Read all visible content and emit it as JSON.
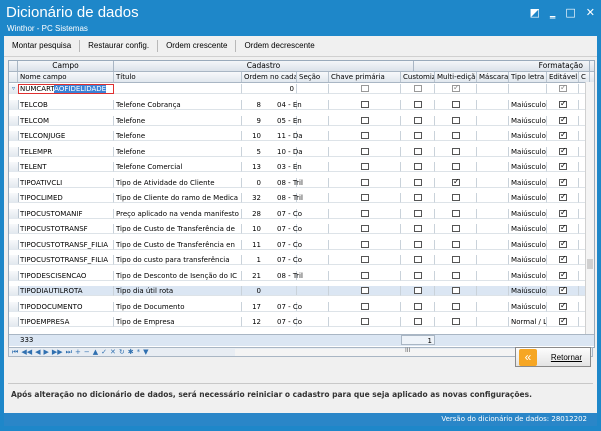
{
  "window": {
    "title": "Dicionário de dados",
    "subtitle": "Winthor - PC Sistemas",
    "buttons": [
      "◩",
      "‗",
      "□",
      "✕"
    ]
  },
  "toolbar": {
    "montar": "Montar pesquisa",
    "restaurar": "Restaurar config.",
    "crescente": "Ordem crescente",
    "decrescente": "Ordem decrescente"
  },
  "grid": {
    "bands": {
      "campo": "Campo",
      "cadastro": "Cadastro",
      "formatacao": "Formatação"
    },
    "headers": {
      "nome": "Nome campo",
      "titulo": "Título",
      "ordem": "Ordem no cadastro",
      "secao": "Seção",
      "chave": "Chave primária",
      "custom": "Customizável",
      "multi": "Multi-edição",
      "mascara": "Máscara",
      "tipoletra": "Tipo letra",
      "editavel": "Editável",
      "extra": "C"
    },
    "edit_row": {
      "nome": "NUMCART",
      "selected": "AOFIDELIDADE",
      "ordem": "0",
      "chave": false,
      "custom": false,
      "multi": true,
      "editavel": true
    },
    "rows": [
      {
        "nome": "TELCOB",
        "titulo": "Telefone Cobrança",
        "ordem": "8",
        "secao": "04 - En",
        "chave": false,
        "custom": false,
        "multi": false,
        "tipoletra": "Maiúsculo",
        "editavel": true
      },
      {
        "nome": "TELCOM",
        "titulo": "Telefone",
        "ordem": "9",
        "secao": "05 - En",
        "chave": false,
        "custom": false,
        "multi": false,
        "tipoletra": "Maiúsculo",
        "editavel": true
      },
      {
        "nome": "TELCONJUGE",
        "titulo": "Telefone",
        "ordem": "10",
        "secao": "11 - Da",
        "chave": false,
        "custom": false,
        "multi": false,
        "tipoletra": "Maiúsculo",
        "editavel": true
      },
      {
        "nome": "TELEMPR",
        "titulo": "Telefone",
        "ordem": "5",
        "secao": "10 - Da",
        "chave": false,
        "custom": false,
        "multi": false,
        "tipoletra": "Maiúsculo",
        "editavel": true
      },
      {
        "nome": "TELENT",
        "titulo": "Telefone Comercial",
        "ordem": "13",
        "secao": "03 - En",
        "chave": false,
        "custom": false,
        "multi": false,
        "tipoletra": "Maiúsculo",
        "editavel": true
      },
      {
        "nome": "TIPOATIVCLI",
        "titulo": "Tipo de Atividade do Cliente",
        "ordem": "0",
        "secao": "08 - Tril",
        "chave": false,
        "custom": false,
        "multi": true,
        "tipoletra": "Maiúsculo",
        "editavel": true
      },
      {
        "nome": "TIPOCLIMED",
        "titulo": "Tipo de Cliente do ramo de Medica",
        "ordem": "32",
        "secao": "08 - Tril",
        "chave": false,
        "custom": false,
        "multi": false,
        "tipoletra": "Maiúsculo",
        "editavel": true
      },
      {
        "nome": "TIPOCUSTOMANIF",
        "titulo": "Preço aplicado na venda manifesto",
        "ordem": "28",
        "secao": "07 - Co",
        "chave": false,
        "custom": false,
        "multi": false,
        "tipoletra": "Maiúsculo",
        "editavel": true
      },
      {
        "nome": "TIPOCUSTOTRANSF",
        "titulo": "Tipo de Custo de Transferência de",
        "ordem": "10",
        "secao": "07 - Co",
        "chave": false,
        "custom": false,
        "multi": false,
        "tipoletra": "Maiúsculo",
        "editavel": true
      },
      {
        "nome": "TIPOCUSTOTRANSF_FILIA",
        "titulo": "Tipo de Custo de Transferência en",
        "ordem": "11",
        "secao": "07 - Co",
        "chave": false,
        "custom": false,
        "multi": false,
        "tipoletra": "Maiúsculo",
        "editavel": true
      },
      {
        "nome": "TIPOCUSTOTRANSF_FILIA",
        "titulo": "Tipo do custo  para transferência",
        "ordem": "1",
        "secao": "07 - Co",
        "chave": false,
        "custom": false,
        "multi": false,
        "tipoletra": "Maiúsculo",
        "editavel": true
      },
      {
        "nome": "TIPODESCISENCAO",
        "titulo": "Tipo de Desconto de Isenção do IC",
        "ordem": "21",
        "secao": "08 - Tril",
        "chave": false,
        "custom": false,
        "multi": false,
        "tipoletra": "Maiúsculo",
        "editavel": true
      },
      {
        "nome": "TIPODIAUTILROTA",
        "titulo": "Tipo dia útil rota",
        "ordem": "0",
        "secao": "",
        "chave": false,
        "custom": false,
        "multi": false,
        "tipoletra": "Maiúsculo",
        "editavel": true
      },
      {
        "nome": "TIPODOCUMENTO",
        "titulo": "Tipo de Documento",
        "ordem": "17",
        "secao": "07 - Co",
        "chave": false,
        "custom": false,
        "multi": false,
        "tipoletra": "Maiúsculo",
        "editavel": true
      },
      {
        "nome": "TIPOEMPRESA",
        "titulo": "Tipo de Empresa",
        "ordem": "12",
        "secao": "07 - Co",
        "chave": false,
        "custom": false,
        "multi": false,
        "tipoletra": "Normal / L",
        "editavel": true
      }
    ],
    "footer": {
      "count": "333",
      "custom_sum": "1"
    }
  },
  "navbar": {
    "buttons": [
      "⏮",
      "◀◀",
      "◀",
      "▶",
      "▶▶",
      "⏭",
      "+",
      "−",
      "▲",
      "✓",
      "✕",
      "↻",
      "✱",
      "*",
      "▼"
    ],
    "scroll_label": "III"
  },
  "retornar": {
    "label": "Retornar",
    "icon": "«"
  },
  "notice": "Após alteração no dicionário de dados, será necessário reiniciar o cadastro para que seja aplicado as novas configurações.",
  "status": "Versão do dicionário de dados: 28012202",
  "colors": {
    "titlebar": "#1e87c9",
    "selection_border": "#e03030",
    "highlight_row": "#dbe6f3"
  }
}
